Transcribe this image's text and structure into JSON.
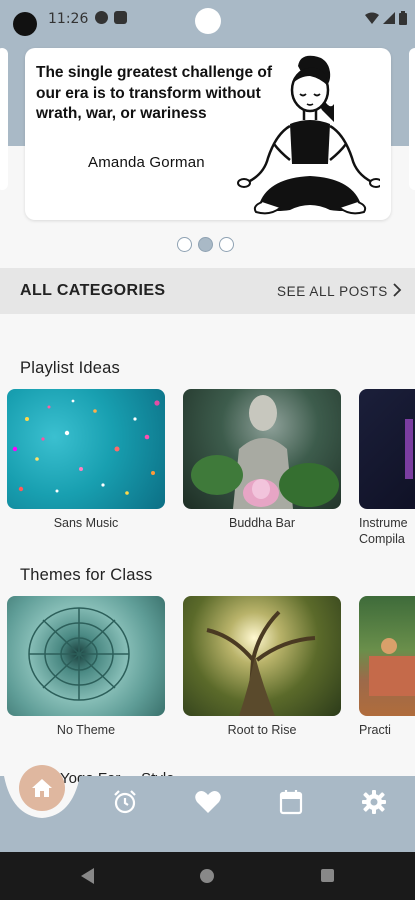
{
  "status_bar": {
    "time": "11:26"
  },
  "quote": {
    "text": "The single greatest challenge of our era is to transform without wrath, war, or wariness",
    "author": "Amanda Gorman"
  },
  "carousel": {
    "page_count": 3,
    "active_index": 1
  },
  "categories": {
    "title": "ALL CATEGORIES",
    "see_all": "SEE ALL POSTS"
  },
  "playlist": {
    "title": "Playlist Ideas",
    "items": [
      {
        "label": "Sans Music"
      },
      {
        "label": "Buddha Bar"
      },
      {
        "label": "Instrume\nCompila"
      }
    ]
  },
  "themes": {
    "title": "Themes for Class",
    "items": [
      {
        "label": "No Theme"
      },
      {
        "label": "Root to Rise"
      },
      {
        "label": "Practi"
      }
    ]
  },
  "next_section_partial": "Yoga For ... Style",
  "nav": {
    "items": [
      "home-icon",
      "alarm-icon",
      "heart-icon",
      "calendar-icon",
      "settings-icon"
    ],
    "active": "home-icon"
  },
  "colors": {
    "header_bg": "#a9b9c6",
    "home_accent": "#dfb79f",
    "category_bar_bg": "#e6e6e6"
  }
}
